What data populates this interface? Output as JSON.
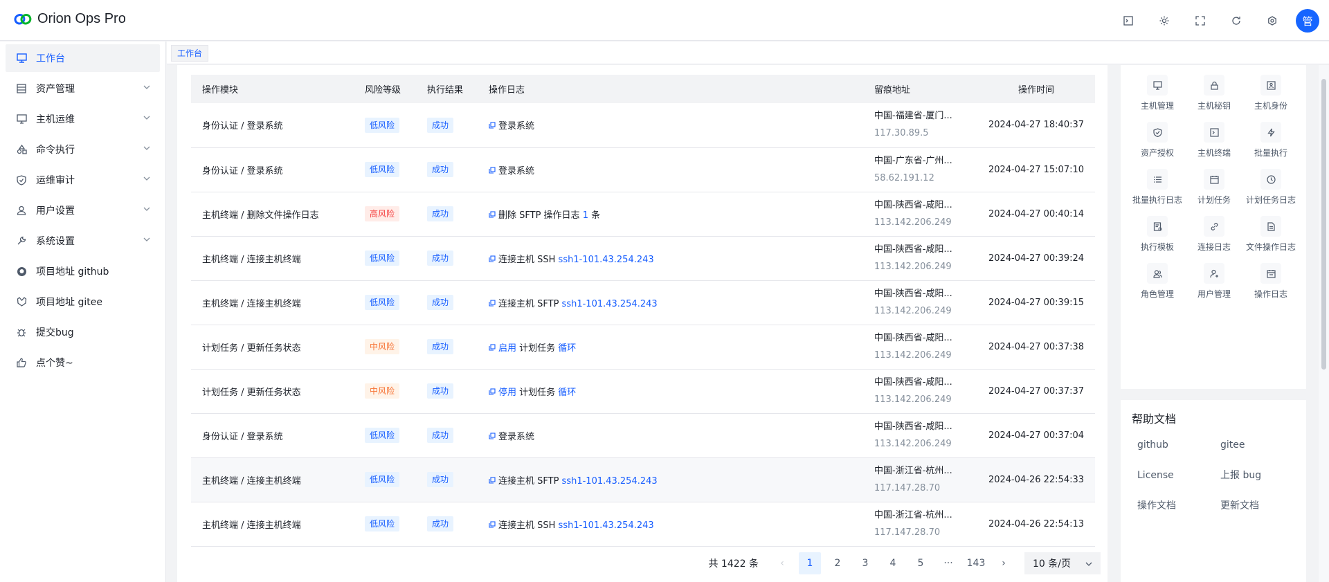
{
  "app": {
    "title": "Orion Ops Pro",
    "avatar_text": "管"
  },
  "topbar": {
    "icons": [
      "terminal-icon",
      "sun-icon",
      "fullscreen-icon",
      "refresh-icon",
      "settings-icon"
    ]
  },
  "sidebar": {
    "items": [
      {
        "label": "工作台",
        "icon": "monitor-icon",
        "active": true,
        "has_children": false
      },
      {
        "label": "资产管理",
        "icon": "list-icon",
        "active": false,
        "has_children": true
      },
      {
        "label": "主机运维",
        "icon": "desktop-icon",
        "active": false,
        "has_children": true
      },
      {
        "label": "命令执行",
        "icon": "shapes-icon",
        "active": false,
        "has_children": true
      },
      {
        "label": "运维审计",
        "icon": "shield-icon",
        "active": false,
        "has_children": true
      },
      {
        "label": "用户设置",
        "icon": "user-icon",
        "active": false,
        "has_children": true
      },
      {
        "label": "系统设置",
        "icon": "wrench-icon",
        "active": false,
        "has_children": true
      },
      {
        "label": "项目地址 github",
        "icon": "github-icon",
        "active": false,
        "has_children": false
      },
      {
        "label": "项目地址 gitee",
        "icon": "gitee-icon",
        "active": false,
        "has_children": false
      },
      {
        "label": "提交bug",
        "icon": "bug-icon",
        "active": false,
        "has_children": false
      },
      {
        "label": "点个赞~",
        "icon": "thumb-up-icon",
        "active": false,
        "has_children": false
      }
    ]
  },
  "tabs": [
    {
      "label": "工作台"
    }
  ],
  "table": {
    "headers": [
      "操作模块",
      "风险等级",
      "执行结果",
      "操作日志",
      "留痕地址",
      "操作时间"
    ],
    "rows": [
      {
        "module": "身份认证 / 登录系统",
        "risk": "低风险",
        "risk_level": "low",
        "result": "成功",
        "log_parts": [
          [
            "",
            "登录系统"
          ]
        ],
        "addr1": "中国-福建省-厦门...",
        "addr2": "117.30.89.5",
        "time": "2024-04-27 18:40:37"
      },
      {
        "module": "身份认证 / 登录系统",
        "risk": "低风险",
        "risk_level": "low",
        "result": "成功",
        "log_parts": [
          [
            "",
            "登录系统"
          ]
        ],
        "addr1": "中国-广东省-广州...",
        "addr2": "58.62.191.12",
        "time": "2024-04-27 15:07:10"
      },
      {
        "module": "主机终端 / 删除文件操作日志",
        "risk": "高风险",
        "risk_level": "high",
        "result": "成功",
        "log_parts": [
          [
            "",
            "删除 SFTP 操作日志 "
          ],
          [
            "hl",
            "1"
          ],
          [
            "",
            " 条"
          ]
        ],
        "addr1": "中国-陕西省-咸阳...",
        "addr2": "113.142.206.249",
        "time": "2024-04-27 00:40:14"
      },
      {
        "module": "主机终端 / 连接主机终端",
        "risk": "低风险",
        "risk_level": "low",
        "result": "成功",
        "log_parts": [
          [
            "",
            "连接主机 SSH "
          ],
          [
            "hl",
            "ssh1-101.43.254.243"
          ]
        ],
        "addr1": "中国-陕西省-咸阳...",
        "addr2": "113.142.206.249",
        "time": "2024-04-27 00:39:24"
      },
      {
        "module": "主机终端 / 连接主机终端",
        "risk": "低风险",
        "risk_level": "low",
        "result": "成功",
        "log_parts": [
          [
            "",
            "连接主机 SFTP "
          ],
          [
            "hl",
            "ssh1-101.43.254.243"
          ]
        ],
        "addr1": "中国-陕西省-咸阳...",
        "addr2": "113.142.206.249",
        "time": "2024-04-27 00:39:15"
      },
      {
        "module": "计划任务 / 更新任务状态",
        "risk": "中风险",
        "risk_level": "mid",
        "result": "成功",
        "log_parts": [
          [
            "hl",
            "启用"
          ],
          [
            "",
            " 计划任务 "
          ],
          [
            "hl",
            "循环"
          ]
        ],
        "addr1": "中国-陕西省-咸阳...",
        "addr2": "113.142.206.249",
        "time": "2024-04-27 00:37:38"
      },
      {
        "module": "计划任务 / 更新任务状态",
        "risk": "中风险",
        "risk_level": "mid",
        "result": "成功",
        "log_parts": [
          [
            "hl",
            "停用"
          ],
          [
            "",
            " 计划任务 "
          ],
          [
            "hl",
            "循环"
          ]
        ],
        "addr1": "中国-陕西省-咸阳...",
        "addr2": "113.142.206.249",
        "time": "2024-04-27 00:37:37"
      },
      {
        "module": "身份认证 / 登录系统",
        "risk": "低风险",
        "risk_level": "low",
        "result": "成功",
        "log_parts": [
          [
            "",
            "登录系统"
          ]
        ],
        "addr1": "中国-陕西省-咸阳...",
        "addr2": "113.142.206.249",
        "time": "2024-04-27 00:37:04"
      },
      {
        "module": "主机终端 / 连接主机终端",
        "risk": "低风险",
        "risk_level": "low",
        "result": "成功",
        "log_parts": [
          [
            "",
            "连接主机 SFTP "
          ],
          [
            "hl",
            "ssh1-101.43.254.243"
          ]
        ],
        "addr1": "中国-浙江省-杭州...",
        "addr2": "117.147.28.70",
        "time": "2024-04-26 22:54:33",
        "highlight": true
      },
      {
        "module": "主机终端 / 连接主机终端",
        "risk": "低风险",
        "risk_level": "low",
        "result": "成功",
        "log_parts": [
          [
            "",
            "连接主机 SSH "
          ],
          [
            "hl",
            "ssh1-101.43.254.243"
          ]
        ],
        "addr1": "中国-浙江省-杭州...",
        "addr2": "117.147.28.70",
        "time": "2024-04-26 22:54:13"
      }
    ]
  },
  "pagination": {
    "total_text": "共 1422 条",
    "pages": [
      "1",
      "2",
      "3",
      "4",
      "5",
      "···",
      "143"
    ],
    "current": "1",
    "page_size": "10 条/页"
  },
  "quick_links": [
    {
      "label": "主机管理",
      "icon": "monitor-icon"
    },
    {
      "label": "主机秘钥",
      "icon": "lock-icon"
    },
    {
      "label": "主机身份",
      "icon": "id-card-icon"
    },
    {
      "label": "资产授权",
      "icon": "shield-check-icon"
    },
    {
      "label": "主机终端",
      "icon": "terminal-icon"
    },
    {
      "label": "批量执行",
      "icon": "bolt-icon"
    },
    {
      "label": "批量执行日志",
      "icon": "list-icon"
    },
    {
      "label": "计划任务",
      "icon": "calendar-icon"
    },
    {
      "label": "计划任务日志",
      "icon": "clock-icon"
    },
    {
      "label": "执行模板",
      "icon": "template-icon"
    },
    {
      "label": "连接日志",
      "icon": "link-icon"
    },
    {
      "label": "文件操作日志",
      "icon": "file-icon"
    },
    {
      "label": "角色管理",
      "icon": "users-icon"
    },
    {
      "label": "用户管理",
      "icon": "user-add-icon"
    },
    {
      "label": "操作日志",
      "icon": "log-icon"
    }
  ],
  "help": {
    "title": "帮助文档",
    "links": [
      "github",
      "gitee",
      "License",
      "上报 bug",
      "操作文档",
      "更新文档"
    ]
  },
  "colors": {
    "primary": "#165dff",
    "low_bg": "#e8f3ff",
    "high_bg": "#ffece8",
    "high_text": "#f53f3f",
    "mid_bg": "#fff3e8",
    "mid_text": "#f77234"
  }
}
